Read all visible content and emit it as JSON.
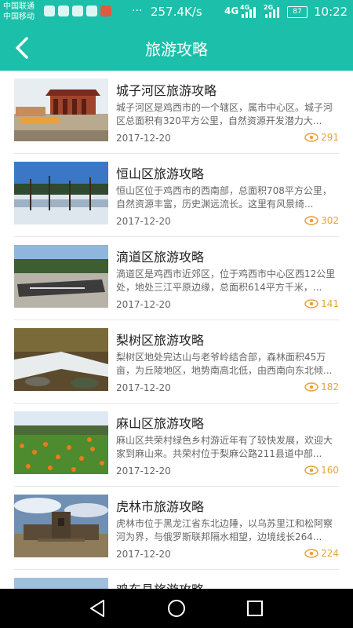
{
  "status_bar": {
    "carrier_1": "中国联通",
    "carrier_2": "中国移动",
    "dots": "···",
    "speed": "257.4K/s",
    "net_1": "4G",
    "net_2": "4G",
    "net_3": "2G",
    "battery": "87",
    "time": "10:22"
  },
  "header": {
    "title": "旅游攻略",
    "back_icon": "chevron-left-icon"
  },
  "colors": {
    "accent": "#1cbfa9",
    "views": "#e8a33c"
  },
  "items": [
    {
      "title": "城子河区旅游攻略",
      "desc": "城子河区是鸡西市的一个辖区，属市中心区。城子河区总面积有320平方公里，自然资源开发潜力大...",
      "date": "2017-12-20",
      "views": "291",
      "image": "temple-photo"
    },
    {
      "title": "恒山区旅游攻略",
      "desc": " 恒山区位于鸡西市的西南部，总面积708平方公里，自然资源丰富，历史渊远流长。这里有风景绮...",
      "date": "2017-12-20",
      "views": "302",
      "image": "winter-lake-photo"
    },
    {
      "title": "滴道区旅游攻略",
      "desc": " 滴道区是鸡西市近郊区，位于鸡西市中心区西12公里处，地处三江平原边缘，总面积614平方千米，...",
      "date": "2017-12-20",
      "views": "141",
      "image": "stone-monument-photo"
    },
    {
      "title": "梨树区旅游攻略",
      "desc": " 梨树区地处完达山与老爷岭结合部，森林面积45万亩，为丘陵地区，地势南高北低，由西南向东北倾...",
      "date": "2017-12-20",
      "views": "182",
      "image": "forest-stream-photo"
    },
    {
      "title": "麻山区旅游攻略",
      "desc": "麻山区共荣村绿色乡村游近年有了较快发展，欢迎大家到麻山来。共荣村位于梨麻公路211县道中部...",
      "date": "2017-12-20",
      "views": "160",
      "image": "flower-field-photo"
    },
    {
      "title": "虎林市旅游攻略",
      "desc": "虎林市位于黑龙江省东北边陲，以乌苏里江和松阿察河为界，与俄罗斯联邦隔水相望，边境线长264...",
      "date": "2017-12-20",
      "views": "224",
      "image": "fortress-photo"
    },
    {
      "title": "鸡东县旅游攻略",
      "desc": "",
      "date": "",
      "views": "",
      "image": "partial-photo"
    }
  ],
  "nav_bar": {
    "back": "triangle-back-icon",
    "home": "circle-home-icon",
    "recents": "square-recents-icon"
  }
}
